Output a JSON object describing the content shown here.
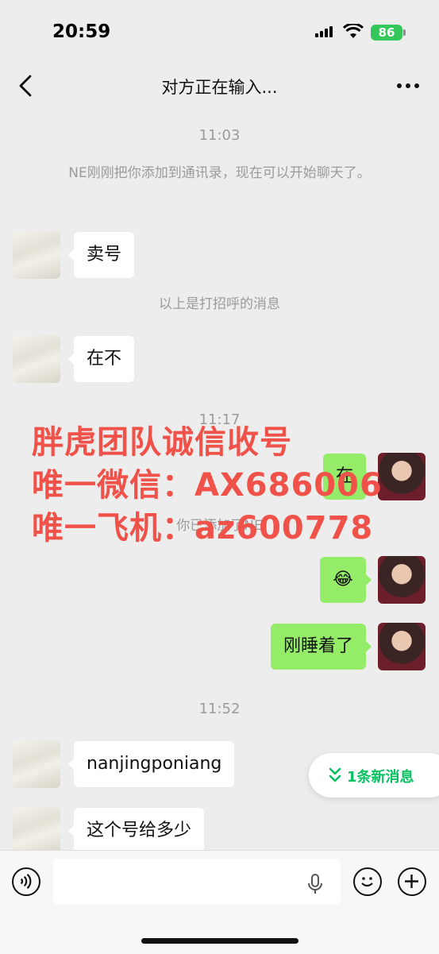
{
  "status_bar": {
    "time": "20:59",
    "battery": "86"
  },
  "nav": {
    "title": "对方正在输入..."
  },
  "messages": {
    "time_1": "11:03",
    "system_added": "NE刚刚把你添加到通讯录，现在可以开始聊天了。",
    "msg_1": "卖号",
    "system_greeting": "以上是打招呼的消息",
    "msg_2": "在不",
    "time_2": "11:17",
    "msg_3": "在",
    "system_you_added": "你已添加了NE",
    "msg_4": "😂",
    "msg_5": "刚睡着了",
    "time_3": "11:52",
    "msg_6": "nanjingponiang",
    "msg_7": "这个号给多少"
  },
  "overlay": {
    "line_1": "胖虎团队诚信收号",
    "line_2": "唯一微信：AX686006",
    "line_3": "唯一飞机：az600778"
  },
  "new_messages": {
    "label": "1条新消息"
  },
  "icons": {
    "back": "chevron-left-icon",
    "more": "more-dots-icon",
    "voice": "voice-icon",
    "mic": "mic-icon",
    "emoji": "emoji-icon",
    "plus": "plus-icon"
  },
  "colors": {
    "bubble_self": "#95ec69",
    "overlay_text": "#f0524a",
    "accent": "#07c160"
  }
}
